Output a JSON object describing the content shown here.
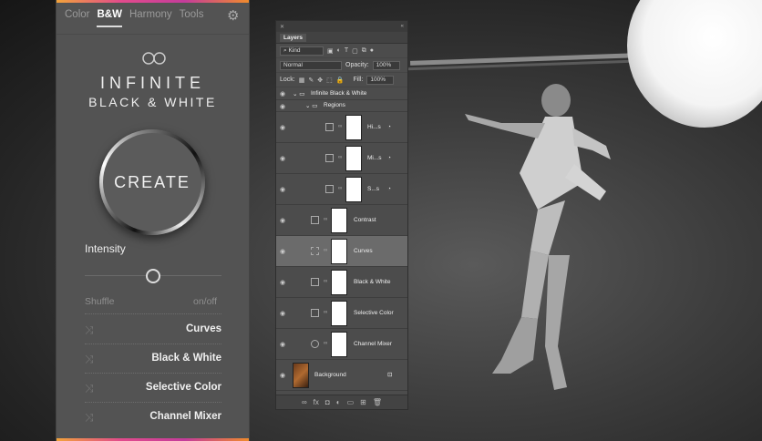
{
  "plugin": {
    "tabs": [
      {
        "label": "Color",
        "active": false
      },
      {
        "label": "B&W",
        "active": true
      },
      {
        "label": "Harmony",
        "active": false
      },
      {
        "label": "Tools",
        "active": false
      }
    ],
    "brand_line1": "INFINITE",
    "brand_line2": "BLACK & WHITE",
    "create_label": "CREATE",
    "intensity_label": "Intensity",
    "intensity_value": 0.5,
    "shuffle_label": "Shuffle",
    "onoff_label": "on/off",
    "adjustments": [
      "Curves",
      "Black & White",
      "Selective Color",
      "Channel Mixer"
    ],
    "accent_gradient": [
      "#f2a33a",
      "#e24b8c",
      "#c43c9b",
      "#f08b2c"
    ]
  },
  "layers_panel": {
    "title": "Layers",
    "kind_filter": "Kind",
    "blend_mode": "Normal",
    "opacity_label": "Opacity:",
    "opacity_value": "100%",
    "lock_label": "Lock:",
    "fill_label": "Fill:",
    "fill_value": "100%",
    "groups": [
      {
        "name": "Infinite Black & White"
      },
      {
        "name": "Regions"
      }
    ],
    "layers": [
      {
        "name": "Hi...s",
        "type": "curves-adjustment"
      },
      {
        "name": "Mi...s",
        "type": "curves-adjustment"
      },
      {
        "name": "S...s",
        "type": "curves-adjustment"
      },
      {
        "name": "Contrast",
        "type": "black-white-adjustment"
      },
      {
        "name": "Curves",
        "type": "curves-adjustment",
        "selected": true
      },
      {
        "name": "Black & White",
        "type": "black-white-adjustment"
      },
      {
        "name": "Selective Color",
        "type": "selective-color-adjustment"
      },
      {
        "name": "Channel Mixer",
        "type": "channel-mixer-adjustment"
      },
      {
        "name": "Background",
        "type": "image",
        "locked": true
      }
    ]
  }
}
